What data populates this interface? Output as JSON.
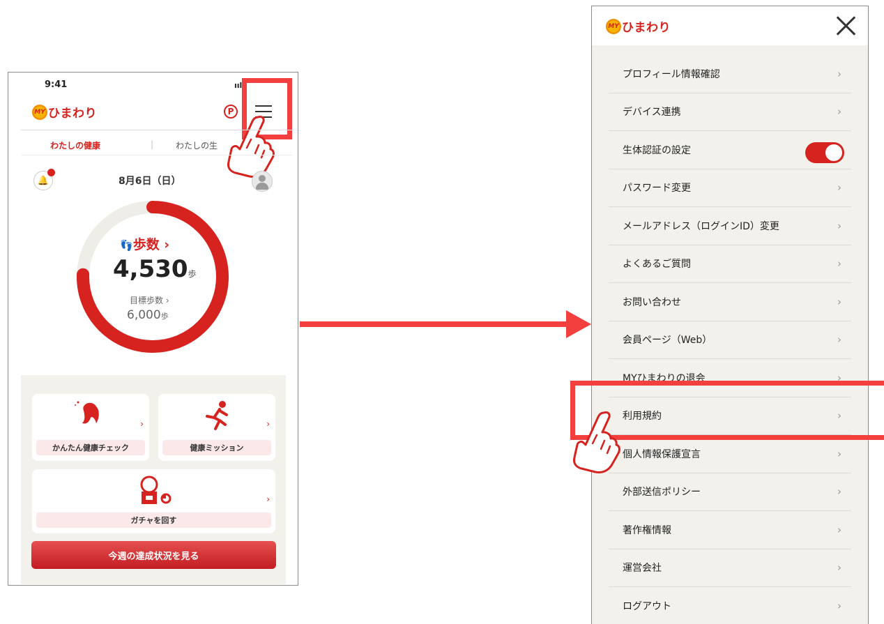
{
  "phone": {
    "status_time": "9:41",
    "signal": "ııl",
    "logo_badge": "MY",
    "logo_text": "ひまわり",
    "points_icon": "P",
    "tabs": [
      {
        "label": "わたしの健康"
      },
      {
        "label": "|"
      },
      {
        "label": "わたしの生"
      }
    ],
    "date": "8月6日（日）",
    "steps": {
      "label": "歩数 ›",
      "value": "4,530",
      "unit": "歩",
      "goal_label": "目標歩数 ›",
      "goal_value": "6,000",
      "goal_unit": "歩",
      "progress_fraction": 0.755
    },
    "cards": [
      {
        "label": "かんたん健康チェック",
        "chevron": "›"
      },
      {
        "label": "健康ミッション",
        "chevron": "›"
      },
      {
        "label": "ガチャを回す",
        "chevron": "›"
      }
    ],
    "cta_label": "今週の達成状況を見る"
  },
  "menu": {
    "logo_badge": "MY",
    "logo_text": "ひまわり",
    "items": [
      {
        "label": "プロフィール情報確認",
        "chevron": "›"
      },
      {
        "label": "デバイス連携",
        "chevron": "›"
      },
      {
        "label": "生体認証の設定",
        "toggle_on": true
      },
      {
        "label": "パスワード変更",
        "chevron": "›"
      },
      {
        "label": "メールアドレス（ログインID）変更",
        "chevron": "›"
      },
      {
        "label": "よくあるご質問",
        "chevron": "›"
      },
      {
        "label": "お問い合わせ",
        "chevron": "›"
      },
      {
        "label": "会員ページ（Web）",
        "chevron": "›"
      },
      {
        "label": "MYひまわりの退会",
        "chevron": "›"
      },
      {
        "label": "利用規約",
        "chevron": "›"
      },
      {
        "label": "個人情報保護宣言",
        "chevron": "›"
      },
      {
        "label": "外部送信ポリシー",
        "chevron": "›"
      },
      {
        "label": "著作権情報",
        "chevron": "›"
      },
      {
        "label": "運営会社",
        "chevron": "›"
      },
      {
        "label": "ログアウト",
        "chevron": "›"
      }
    ]
  },
  "colors": {
    "brand_red": "#d6231f",
    "highlight_red": "#f43f3f",
    "menu_bg": "#f2f1ec",
    "ring_track": "#eeede8"
  }
}
